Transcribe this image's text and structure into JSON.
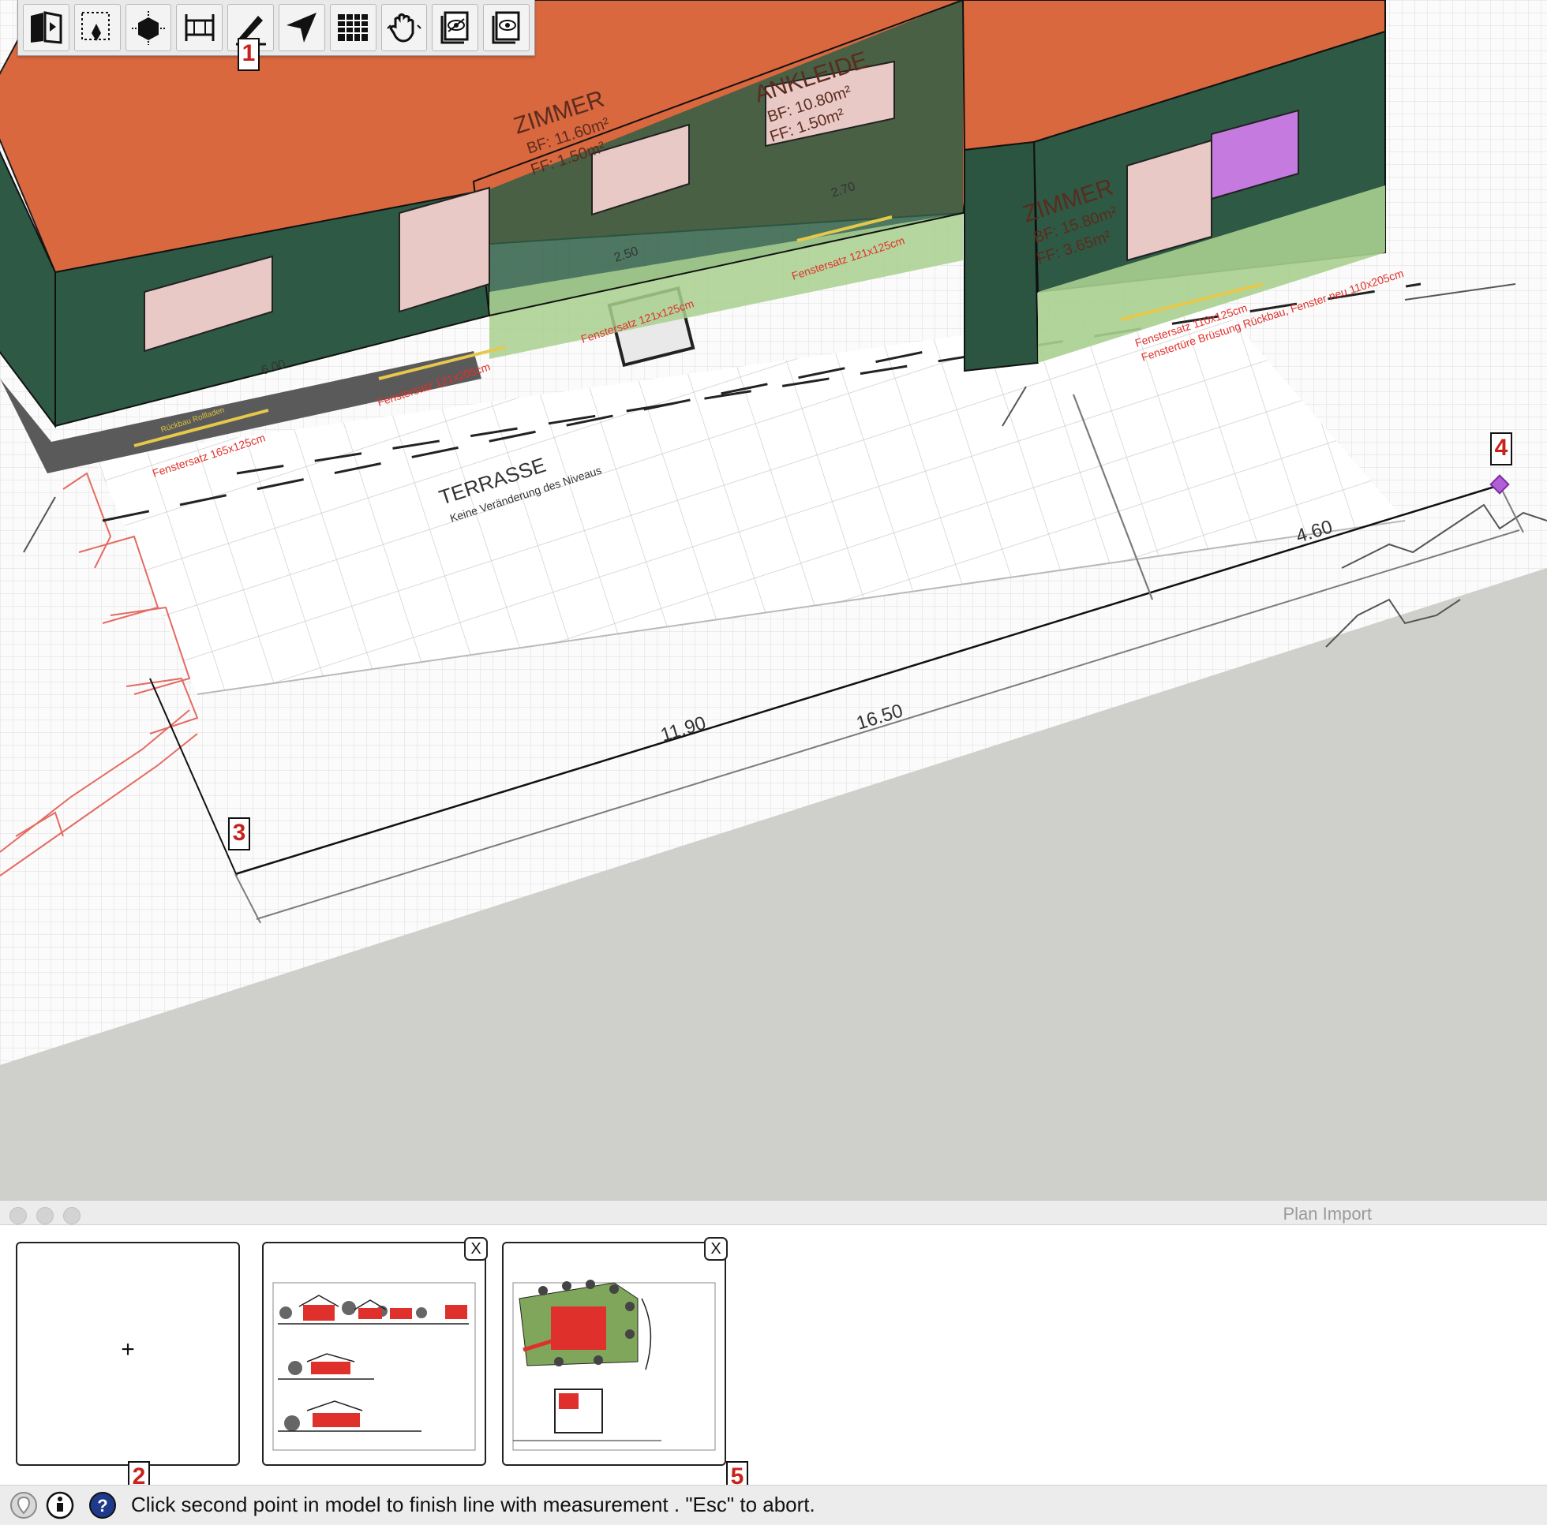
{
  "toolbar": {
    "tools": [
      {
        "name": "book-play-icon"
      },
      {
        "name": "selection-pen-icon"
      },
      {
        "name": "cube-move-icon"
      },
      {
        "name": "dimension-icon"
      },
      {
        "name": "pencil-icon"
      },
      {
        "name": "navigate-arrow-icon"
      },
      {
        "name": "table-grid-icon"
      },
      {
        "name": "hand-pan-icon"
      },
      {
        "name": "layers-eye-icon"
      },
      {
        "name": "layers-eye-alt-icon"
      }
    ]
  },
  "markers": {
    "m1": "1",
    "m2": "2",
    "m3": "3",
    "m4": "4",
    "m5": "5"
  },
  "plan": {
    "room1_name": "ZIMMER",
    "room1_bf": "BF: 11.60m²",
    "room1_ff": "FF: 1.50m²",
    "room2_name": "ANKLEIDE",
    "room2_bf": "BF: 10.80m²",
    "room2_ff": "FF: 1.50m²",
    "room3_name": "ZIMMER",
    "room3_bf": "BF: 15.80m²",
    "room3_ff": "FF: 3.65m²",
    "terrace": "TERRASSE",
    "terrace_note": "Keine Veränderung des Niveaus",
    "dim_600": "6.00",
    "dim_270": "2.70",
    "dim_250": "2.50",
    "window_1": "Fenstersatz 165x125cm",
    "window_2": "Fenstersatz 121x205cm",
    "window_3": "Fenstersatz 121x125cm",
    "window_4": "Fenstersatz 121x125cm",
    "window_5": "Fenstersatz 110x125cm",
    "window_6": "Fenstertüre Brüstung Rückbau, Fenster neu 110x205cm",
    "rollladen": "Rückbau Rollladen"
  },
  "measurements": {
    "d_1190": "11.90",
    "d_1650": "16.50",
    "d_460": "4.60"
  },
  "panel": {
    "title": "Plan Import",
    "add_label": "+",
    "close_label_1": "X",
    "close_label_2": "X"
  },
  "status": {
    "message": "Click second point in model to finish line with measurement . \"Esc\" to abort."
  },
  "colors": {
    "roof": "#d9683f",
    "wall": "#2e5a45",
    "glass": "#a9cf8f",
    "window": "#e8c9c6",
    "purple": "#c57ae0",
    "annotation": "#e0302b"
  }
}
